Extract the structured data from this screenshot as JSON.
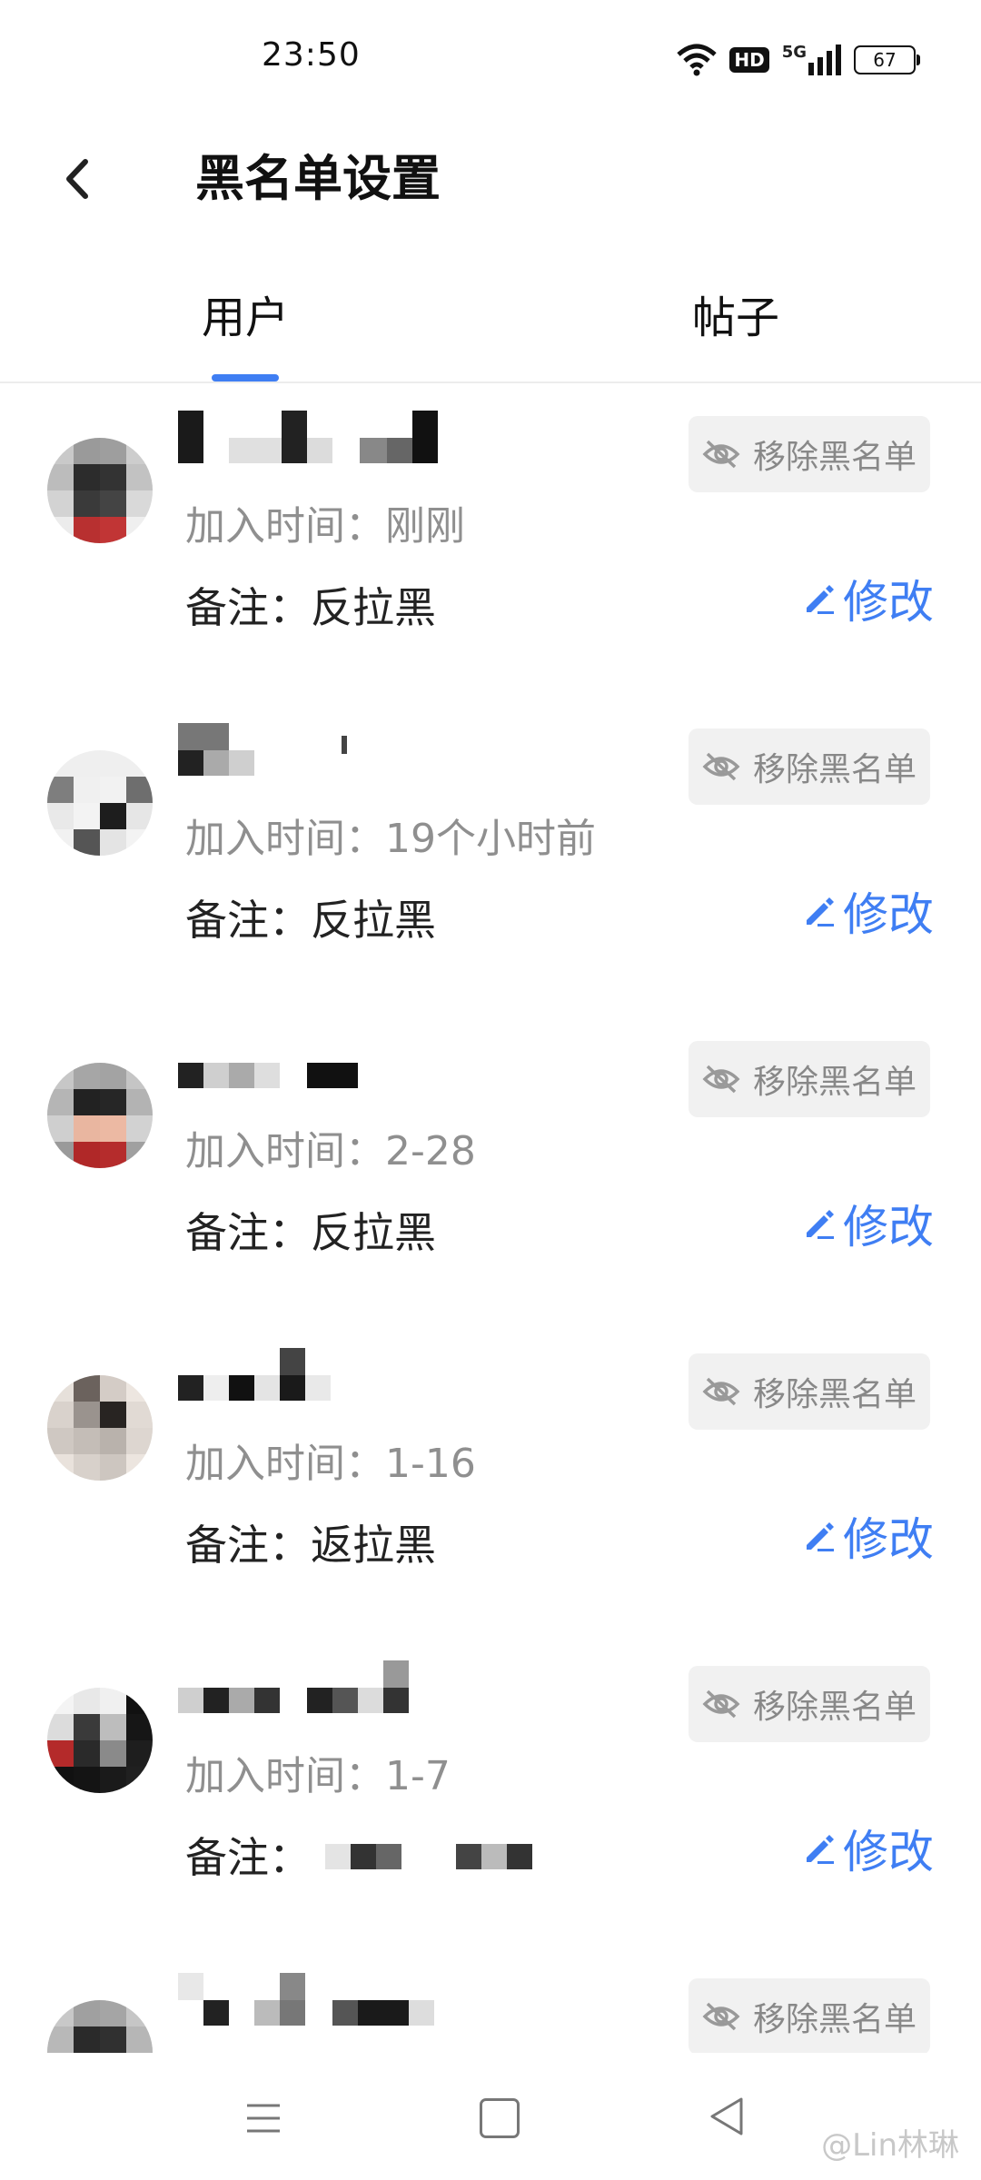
{
  "status_bar": {
    "time": "23:50",
    "hd": "HD",
    "network": "5G",
    "battery": "67"
  },
  "header": {
    "title": "黑名单设置"
  },
  "tabs": [
    {
      "label": "用户"
    },
    {
      "label": "帖子"
    }
  ],
  "buttons": {
    "remove": "移除黑名单",
    "edit": "修改"
  },
  "items": [
    {
      "time": "加入时间：刚刚",
      "note": "备注：反拉黑"
    },
    {
      "time": "加入时间：19个小时前",
      "note": "备注：反拉黑"
    },
    {
      "time": "加入时间：2-28",
      "note": "备注：反拉黑"
    },
    {
      "time": "加入时间：1-16",
      "note": "备注：返拉黑"
    },
    {
      "time": "加入时间：1-7",
      "note": "备注："
    },
    {
      "time": "",
      "note": ""
    }
  ],
  "watermark": "@Lin林琳",
  "colors": {
    "accent": "#3f7ef3",
    "muted_text": "#8f8f8f",
    "button_bg": "#f1f1f1"
  },
  "icons": {
    "back": "chevron-left-icon",
    "remove": "eye-slash-icon",
    "edit": "pencil-icon"
  }
}
